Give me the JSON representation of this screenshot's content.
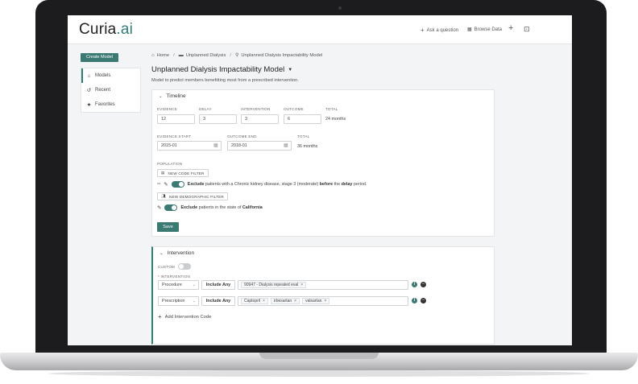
{
  "app": {
    "logo_main": "Curia",
    "logo_accent": ".ai"
  },
  "topbar": {
    "ask_label": "Ask a question",
    "browse_label": "Browse Data"
  },
  "sidebar": {
    "create_label": "Create Model",
    "items": [
      {
        "label": "Models",
        "icon": "home-icon"
      },
      {
        "label": "Recent",
        "icon": "history-icon"
      },
      {
        "label": "Favorites",
        "icon": "star-icon"
      }
    ]
  },
  "breadcrumb": {
    "home": "Home",
    "folder": "Unplanned Dialysis",
    "current": "Unplanned Dialysis Impactability Model"
  },
  "page": {
    "title": "Unplanned Dialysis Impactability Model",
    "description": "Model to predict members benefitting most from a prescribed intervention."
  },
  "timeline": {
    "heading": "Timeline",
    "evidence_label": "EVIDENCE",
    "evidence_value": "12",
    "delay_label": "DELAY",
    "delay_value": "3",
    "intervention_label": "INTERVENTION",
    "intervention_value": "3",
    "outcome_label": "OUTCOME",
    "outcome_value": "6",
    "total_label": "TOTAL",
    "total_value": "24 months",
    "evidence_start_label": "EVIDENCE START",
    "evidence_start_value": "2015-01",
    "outcome_end_label": "OUTCOME END",
    "outcome_end_value": "2018-01",
    "total2_label": "TOTAL",
    "total2_value": "36 months",
    "population_label": "POPULATION",
    "code_filter_label": "NEW CODE FILTER",
    "demo_filter_label": "NEW DEMOGRAPHIC FILTER",
    "rule1": {
      "exclude": "Exclude",
      "text1": "patients with a Chronic kidney disease, stage 3 (moderate)",
      "before": "before",
      "text2": "the",
      "delay": "delay",
      "text3": "period."
    },
    "rule2": {
      "exclude": "Exclude",
      "text1": "patients in the state of",
      "state": "California"
    },
    "save_label": "Save"
  },
  "intervention": {
    "heading": "Intervention",
    "custom_label": "CUSTOM",
    "required_mark": "*",
    "field_label": "INTERVENTION",
    "rows": [
      {
        "type": "Procedure",
        "match": "Include Any",
        "tags": [
          "90947 - Dialysis repeated eval"
        ]
      },
      {
        "type": "Prescription",
        "match": "Include Any",
        "tags": [
          "Captopril",
          "irbesartan",
          "valsartan"
        ]
      }
    ],
    "add_label": "Add Intervention Code"
  },
  "colors": {
    "accent": "#3b7a72",
    "brand": "#2f7f79"
  }
}
